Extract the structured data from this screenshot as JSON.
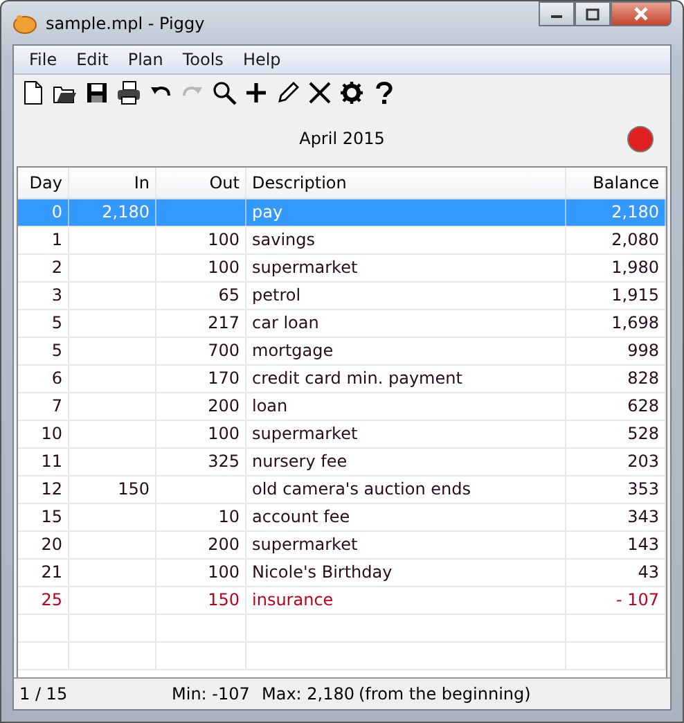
{
  "window": {
    "title": "sample.mpl - Piggy"
  },
  "menu": [
    "File",
    "Edit",
    "Plan",
    "Tools",
    "Help"
  ],
  "toolbar": [
    {
      "kind": "new",
      "disabled": false
    },
    {
      "kind": "open",
      "disabled": false
    },
    {
      "kind": "save",
      "disabled": false
    },
    {
      "kind": "print",
      "disabled": false
    },
    {
      "kind": "undo",
      "disabled": false
    },
    {
      "kind": "redo",
      "disabled": true
    },
    {
      "kind": "search",
      "disabled": false
    },
    {
      "kind": "add",
      "disabled": false
    },
    {
      "kind": "edit",
      "disabled": false
    },
    {
      "kind": "delete",
      "disabled": false
    },
    {
      "kind": "settings",
      "disabled": false
    },
    {
      "kind": "help",
      "disabled": false
    }
  ],
  "period": "April 2015",
  "alert": {
    "color": "#e02020"
  },
  "table": {
    "columns": [
      "Day",
      "In",
      "Out",
      "Description",
      "Balance"
    ],
    "rows": [
      {
        "day": "0",
        "in": "2,180",
        "out": "",
        "description": "pay",
        "balance": "2,180",
        "selected": true,
        "negative": false
      },
      {
        "day": "1",
        "in": "",
        "out": "100",
        "description": "savings",
        "balance": "2,080",
        "selected": false,
        "negative": false
      },
      {
        "day": "2",
        "in": "",
        "out": "100",
        "description": "supermarket",
        "balance": "1,980",
        "selected": false,
        "negative": false
      },
      {
        "day": "3",
        "in": "",
        "out": "65",
        "description": "petrol",
        "balance": "1,915",
        "selected": false,
        "negative": false
      },
      {
        "day": "5",
        "in": "",
        "out": "217",
        "description": "car loan",
        "balance": "1,698",
        "selected": false,
        "negative": false
      },
      {
        "day": "5",
        "in": "",
        "out": "700",
        "description": "mortgage",
        "balance": "998",
        "selected": false,
        "negative": false
      },
      {
        "day": "6",
        "in": "",
        "out": "170",
        "description": "credit card min. payment",
        "balance": "828",
        "selected": false,
        "negative": false
      },
      {
        "day": "7",
        "in": "",
        "out": "200",
        "description": "loan",
        "balance": "628",
        "selected": false,
        "negative": false
      },
      {
        "day": "10",
        "in": "",
        "out": "100",
        "description": "supermarket",
        "balance": "528",
        "selected": false,
        "negative": false
      },
      {
        "day": "11",
        "in": "",
        "out": "325",
        "description": "nursery fee",
        "balance": "203",
        "selected": false,
        "negative": false
      },
      {
        "day": "12",
        "in": "150",
        "out": "",
        "description": "old camera's auction ends",
        "balance": "353",
        "selected": false,
        "negative": false
      },
      {
        "day": "15",
        "in": "",
        "out": "10",
        "description": "account fee",
        "balance": "343",
        "selected": false,
        "negative": false
      },
      {
        "day": "20",
        "in": "",
        "out": "200",
        "description": "supermarket",
        "balance": "143",
        "selected": false,
        "negative": false
      },
      {
        "day": "21",
        "in": "",
        "out": "100",
        "description": "Nicole's Birthday",
        "balance": "43",
        "selected": false,
        "negative": false
      },
      {
        "day": "25",
        "in": "",
        "out": "150",
        "description": "insurance",
        "balance": "- 107",
        "selected": false,
        "negative": true
      }
    ]
  },
  "status_bar": {
    "position": "1 / 15",
    "min": "Min: -107",
    "max": "Max: 2,180",
    "note": "(from the beginning)"
  }
}
